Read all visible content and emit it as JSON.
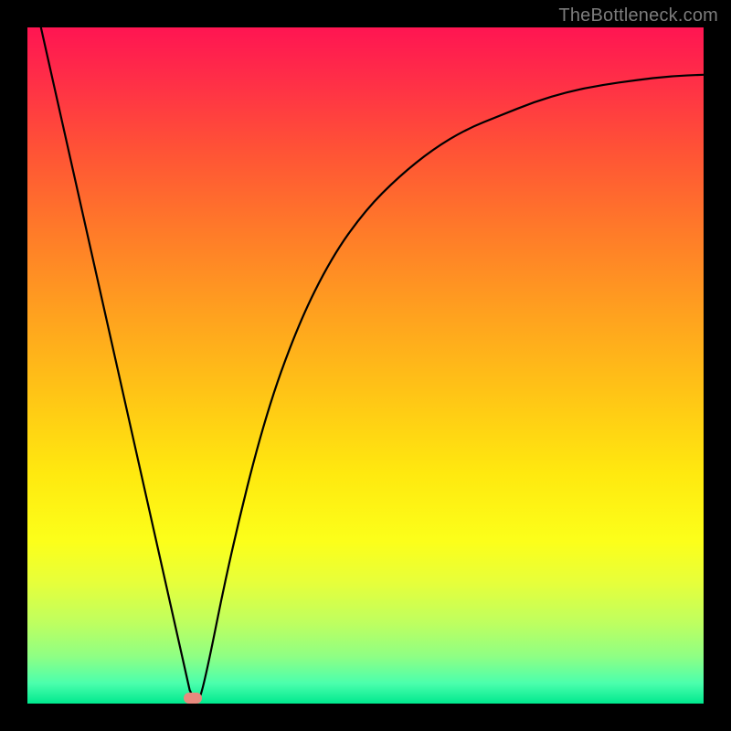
{
  "watermark": "TheBottleneck.com",
  "chart_data": {
    "type": "line",
    "title": "",
    "xlabel": "",
    "ylabel": "",
    "xlim": [
      0,
      100
    ],
    "ylim": [
      0,
      100
    ],
    "series": [
      {
        "name": "curve",
        "x": [
          2,
          24,
          25,
          26,
          30,
          35,
          40,
          45,
          50,
          55,
          60,
          65,
          70,
          75,
          80,
          85,
          90,
          95,
          100
        ],
        "y": [
          100,
          2,
          0,
          2,
          22,
          42,
          56,
          66,
          73,
          78,
          82,
          85,
          87,
          89,
          90.5,
          91.5,
          92.2,
          92.8,
          93
        ]
      }
    ],
    "marker": {
      "x": 24.5,
      "y": 0.8,
      "color": "#e88a7e"
    },
    "background_gradient": {
      "top": "#ff1552",
      "bottom": "#00e98e"
    }
  }
}
